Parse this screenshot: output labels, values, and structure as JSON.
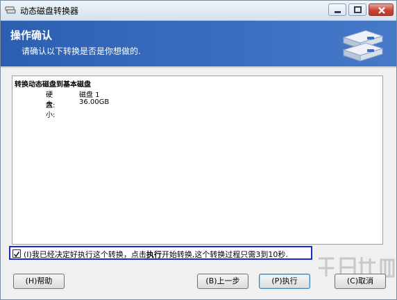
{
  "window": {
    "title": "动态磁盘转换器"
  },
  "header": {
    "title": "操作确认",
    "subtitle": "请确认以下转换是否是你想做的."
  },
  "operation": {
    "title": "转换动态磁盘到基本磁盘",
    "disk_label": "硬盘:",
    "disk_value": "磁盘 1",
    "size_label": "大小:",
    "size_value": "36.00GB"
  },
  "confirm": {
    "checked": true,
    "prefix": "(I)我已经决定好执行这个转换，点击",
    "bold": "执行",
    "suffix": "开始转换,这个转换过程只需3到10秒."
  },
  "buttons": {
    "help": "(H)帮助",
    "back": "(B)上一步",
    "run": "(P)执行",
    "cancel": "(C)取消"
  },
  "colors": {
    "banner": "#3a6fc0",
    "focus_border": "#1a28d0"
  }
}
